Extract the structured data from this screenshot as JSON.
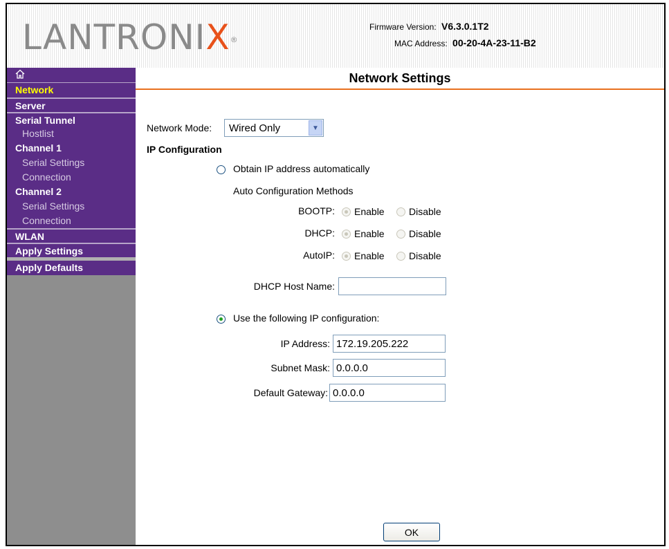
{
  "header": {
    "logo_text": "LANTRONI",
    "logo_x": "X",
    "logo_reg": "®",
    "firmware_label": "Firmware Version:",
    "firmware_value": "V6.3.0.1T2",
    "mac_label": "MAC Address:",
    "mac_value": "00-20-4A-23-11-B2",
    "brand_accent": "#e8511a"
  },
  "sidebar": {
    "home_icon": "home-icon",
    "items": [
      {
        "label": "Network",
        "type": "item",
        "selected": true
      },
      {
        "label": "Server",
        "type": "item"
      },
      {
        "label": "Serial Tunnel",
        "type": "item"
      },
      {
        "label": "Hostlist",
        "type": "sub"
      },
      {
        "label": "Channel 1",
        "type": "item"
      },
      {
        "label": "Serial Settings",
        "type": "sub"
      },
      {
        "label": "Connection",
        "type": "sub"
      },
      {
        "label": "Channel 2",
        "type": "item"
      },
      {
        "label": "Serial Settings",
        "type": "sub"
      },
      {
        "label": "Connection",
        "type": "sub"
      },
      {
        "label": "WLAN",
        "type": "item"
      },
      {
        "label": "Apply Settings",
        "type": "item"
      },
      {
        "label": "Apply Defaults",
        "type": "item"
      }
    ],
    "bg_color": "#5a2d86",
    "selected_color": "#ffff00"
  },
  "page": {
    "title": "Network Settings",
    "accent_rule": "#e8701e"
  },
  "form": {
    "network_mode_label": "Network Mode:",
    "network_mode_value": "Wired Only",
    "ip_config_heading": "IP Configuration",
    "obtain_auto_label": "Obtain IP address automatically",
    "auto_methods_label": "Auto Configuration Methods",
    "bootp_label": "BOOTP:",
    "dhcp_label": "DHCP:",
    "autoip_label": "AutoIP:",
    "enable_label": "Enable",
    "disable_label": "Disable",
    "dhcp_host_label": "DHCP Host Name:",
    "dhcp_host_value": "",
    "use_following_label": "Use the following IP configuration:",
    "ip_address_label": "IP Address:",
    "ip_address_value": "172.19.205.222",
    "subnet_label": "Subnet Mask:",
    "subnet_value": "0.0.0.0",
    "gateway_label": "Default Gateway:",
    "gateway_value": "0.0.0.0",
    "ok_label": "OK"
  }
}
